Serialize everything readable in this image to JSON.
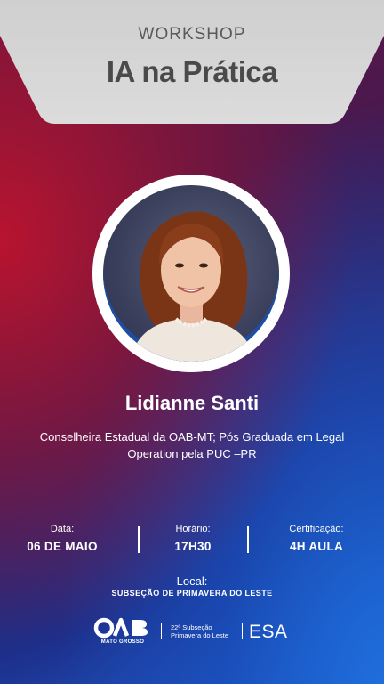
{
  "header": {
    "eyebrow": "WORKSHOP",
    "title": "IA na Prática"
  },
  "speaker": {
    "name": "Lidianne Santi",
    "bio": "Conselheira Estadual da OAB-MT; Pós Graduada em Legal Operation pela PUC –PR"
  },
  "info": [
    {
      "label": "Data:",
      "value": "06 DE MAIO"
    },
    {
      "label": "Horário:",
      "value": "17H30"
    },
    {
      "label": "Certificação:",
      "value": "4H AULA"
    }
  ],
  "local": {
    "label": "Local:",
    "value": "SUBSEÇÃO DE PRIMAVERA DO LESTE"
  },
  "footer": {
    "oab_logo": "OAB",
    "oab_sub": "MATO GROSSO",
    "subsecao_line1": "22ª Subseção",
    "subsecao_line2": "Primavera do Leste",
    "esa": "ESA"
  },
  "colors": {
    "header_bg": "#d4d4d4",
    "title": "#4a4a4a",
    "red": "#be142d",
    "blue": "#1f5ccc"
  }
}
